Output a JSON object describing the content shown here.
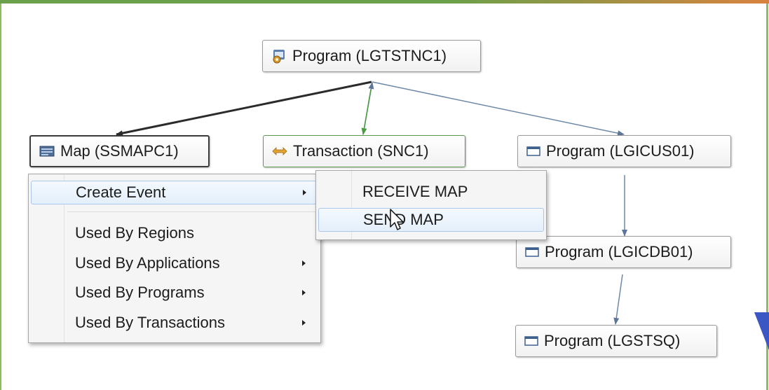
{
  "colors": {
    "edge_dark": "#2b2b2b",
    "edge_blue": "#6e88a8",
    "edge_green": "#4a9b40",
    "frame_green": "#8bbd63",
    "highlight": "#e4effb"
  },
  "nodes": {
    "root": {
      "label": "Program (LGTSTNC1)",
      "icon": "program-icon"
    },
    "map": {
      "label": "Map (SSMAPC1)",
      "icon": "map-icon"
    },
    "transaction": {
      "label": "Transaction (SNC1)",
      "icon": "transaction-icon"
    },
    "program_cus": {
      "label": "Program (LGICUS01)",
      "icon": "program-window-icon"
    },
    "program_cdb": {
      "label": "Program (LGICDB01)",
      "icon": "program-window-icon"
    },
    "program_tsq": {
      "label": "Program (LGSTSQ)",
      "icon": "program-window-icon"
    }
  },
  "context_menu": {
    "create_event": "Create Event",
    "used_by_regions": "Used By Regions",
    "used_by_applications": "Used By Applications",
    "used_by_programs": "Used By Programs",
    "used_by_transactions": "Used By Transactions"
  },
  "submenu": {
    "receive_map": "RECEIVE MAP",
    "send_map": "SEND MAP"
  }
}
